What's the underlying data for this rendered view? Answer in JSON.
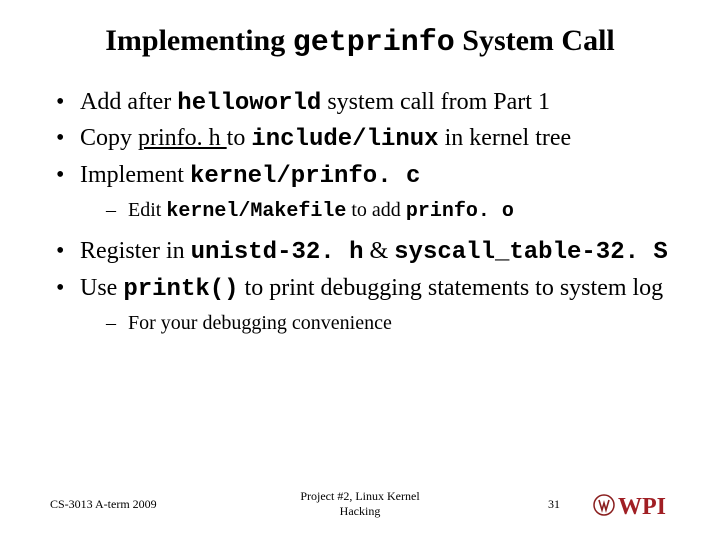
{
  "title": {
    "t1": "Implementing ",
    "code": "getprinfo",
    "t2": " System Call"
  },
  "bullets": {
    "b1": {
      "a": "Add after ",
      "code": "helloworld",
      "b": " system call from Part 1"
    },
    "b2": {
      "a": "Copy ",
      "link": "prinfo. h ",
      "b": "to ",
      "code": "include/linux",
      "c": " in kernel tree"
    },
    "b3": {
      "a": "Implement ",
      "code": "kernel/prinfo. c"
    },
    "b3s": {
      "a": "Edit ",
      "code1": "kernel/Makefile",
      "b": " to add ",
      "code2": "prinfo. o"
    },
    "b4": {
      "a": "Register in ",
      "code1": "unistd-32. h",
      "amp": " & ",
      "code2": "syscall_table-32. S"
    },
    "b5": {
      "a": "Use ",
      "code": "printk()",
      "b": " to print debugging statements to system log"
    },
    "b5s": {
      "a": "For your debugging convenience"
    }
  },
  "footer": {
    "left": "CS-3013 A-term 2009",
    "center1": "Project #2, Linux Kernel",
    "center2": "Hacking",
    "page": "31",
    "logo_text": "WPI"
  }
}
